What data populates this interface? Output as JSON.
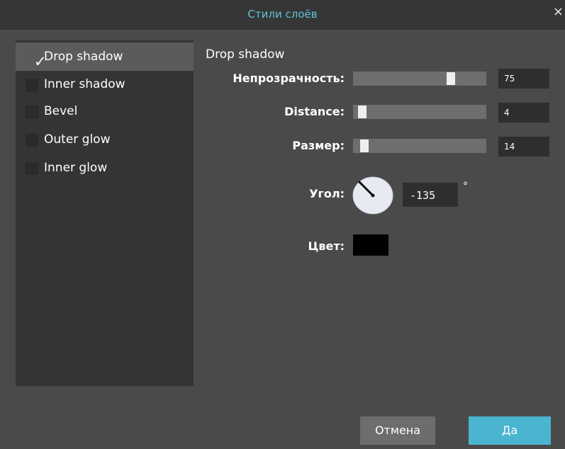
{
  "dialog": {
    "title": "Стили слоёв",
    "close_glyph": "×",
    "accent_color": "#5ec3d8"
  },
  "styles_list": [
    {
      "label": "Drop shadow",
      "checked": true
    },
    {
      "label": "Inner shadow",
      "checked": false
    },
    {
      "label": "Bevel",
      "checked": false
    },
    {
      "label": "Outer glow",
      "checked": false
    },
    {
      "label": "Inner glow",
      "checked": false
    }
  ],
  "check_glyph": "✓",
  "settings": {
    "section_title": "Drop shadow",
    "opacity": {
      "label": "Непрозрачность:",
      "value": "75",
      "max": 100
    },
    "distance": {
      "label": "Distance:",
      "value": "4",
      "max": 100
    },
    "size": {
      "label": "Размер:",
      "value": "14",
      "max": 250
    },
    "angle": {
      "label": "Угол:",
      "value": "-135",
      "unit": "°"
    },
    "color": {
      "label": "Цвет:",
      "value": "#000000"
    }
  },
  "buttons": {
    "cancel": "Отмена",
    "ok": "Да",
    "ok_color": "#4ab4d1"
  }
}
